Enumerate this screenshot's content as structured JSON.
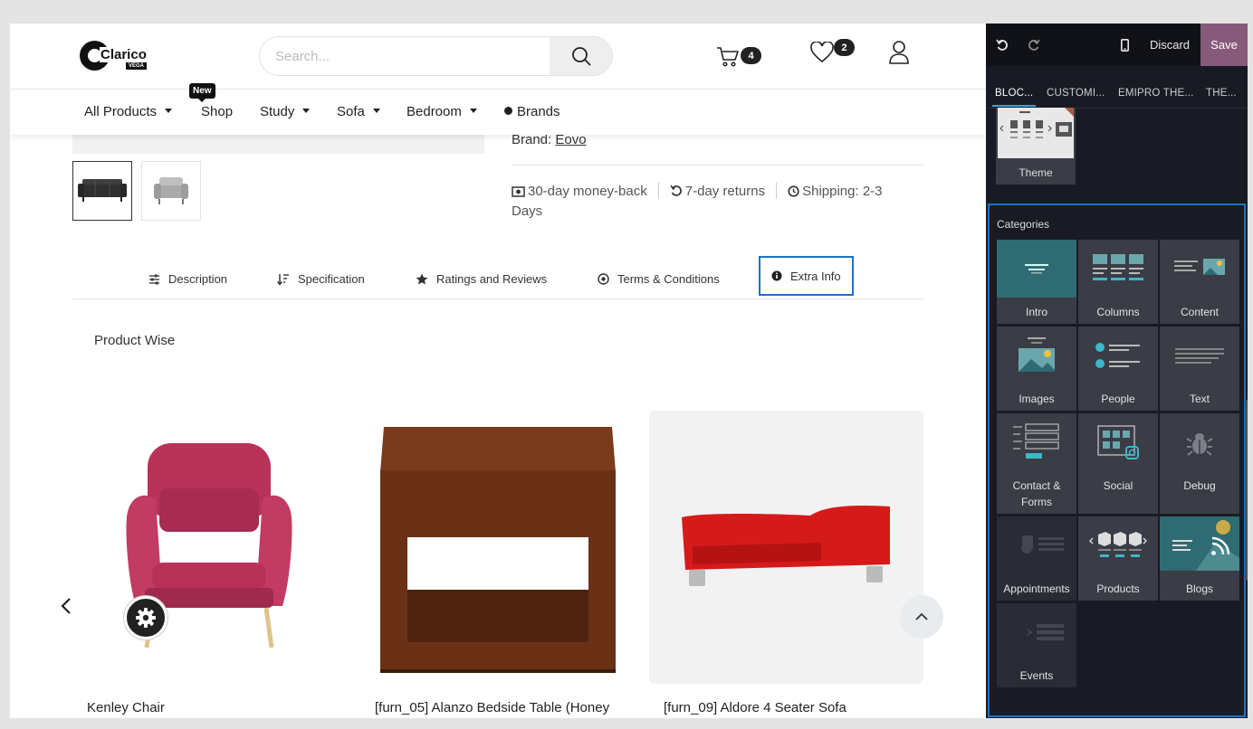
{
  "site": {
    "logo": {
      "word": "Clarico",
      "tag": "VEGA"
    },
    "search": {
      "placeholder": "Search..."
    },
    "cart_count": "4",
    "wishlist_count": "2",
    "nav": [
      {
        "label": "All Products",
        "dropdown": true
      },
      {
        "label": "Shop",
        "dropdown": false,
        "badge": "New"
      },
      {
        "label": "Study",
        "dropdown": true
      },
      {
        "label": "Sofa",
        "dropdown": true
      },
      {
        "label": "Bedroom",
        "dropdown": true
      },
      {
        "label": "Brands",
        "dropdown": false
      }
    ],
    "product": {
      "brand_label": "Brand:",
      "brand_value": "Eovo",
      "perks": [
        "30-day money-back",
        "7-day returns",
        "Shipping: 2-3 Days"
      ]
    },
    "tabs": [
      "Description",
      "Specification",
      "Ratings and Reviews",
      "Terms & Conditions",
      "Extra Info"
    ],
    "active_tab": "Extra Info",
    "section_title": "Product Wise",
    "products": [
      {
        "name": "Kenley Chair"
      },
      {
        "name": "[furn_05] Alanzo Bedside Table (Honey"
      },
      {
        "name": "[furn_09] Aldore 4 Seater Sofa"
      }
    ]
  },
  "editor": {
    "discard": "Discard",
    "save": "Save",
    "tabs": [
      "BLOC...",
      "CUSTOMI...",
      "EMIPRO THE...",
      "THE..."
    ],
    "theme_label": "Theme",
    "categories_title": "Categories",
    "categories": [
      "Intro",
      "Columns",
      "Content",
      "Images",
      "People",
      "Text",
      "Contact & Forms",
      "Social",
      "Debug",
      "Appointments",
      "Products",
      "Blogs",
      "Events"
    ]
  },
  "colors": {
    "accent_blue": "#1b73c6",
    "save_purple": "#875a7b",
    "editor_bg": "#191b24"
  }
}
